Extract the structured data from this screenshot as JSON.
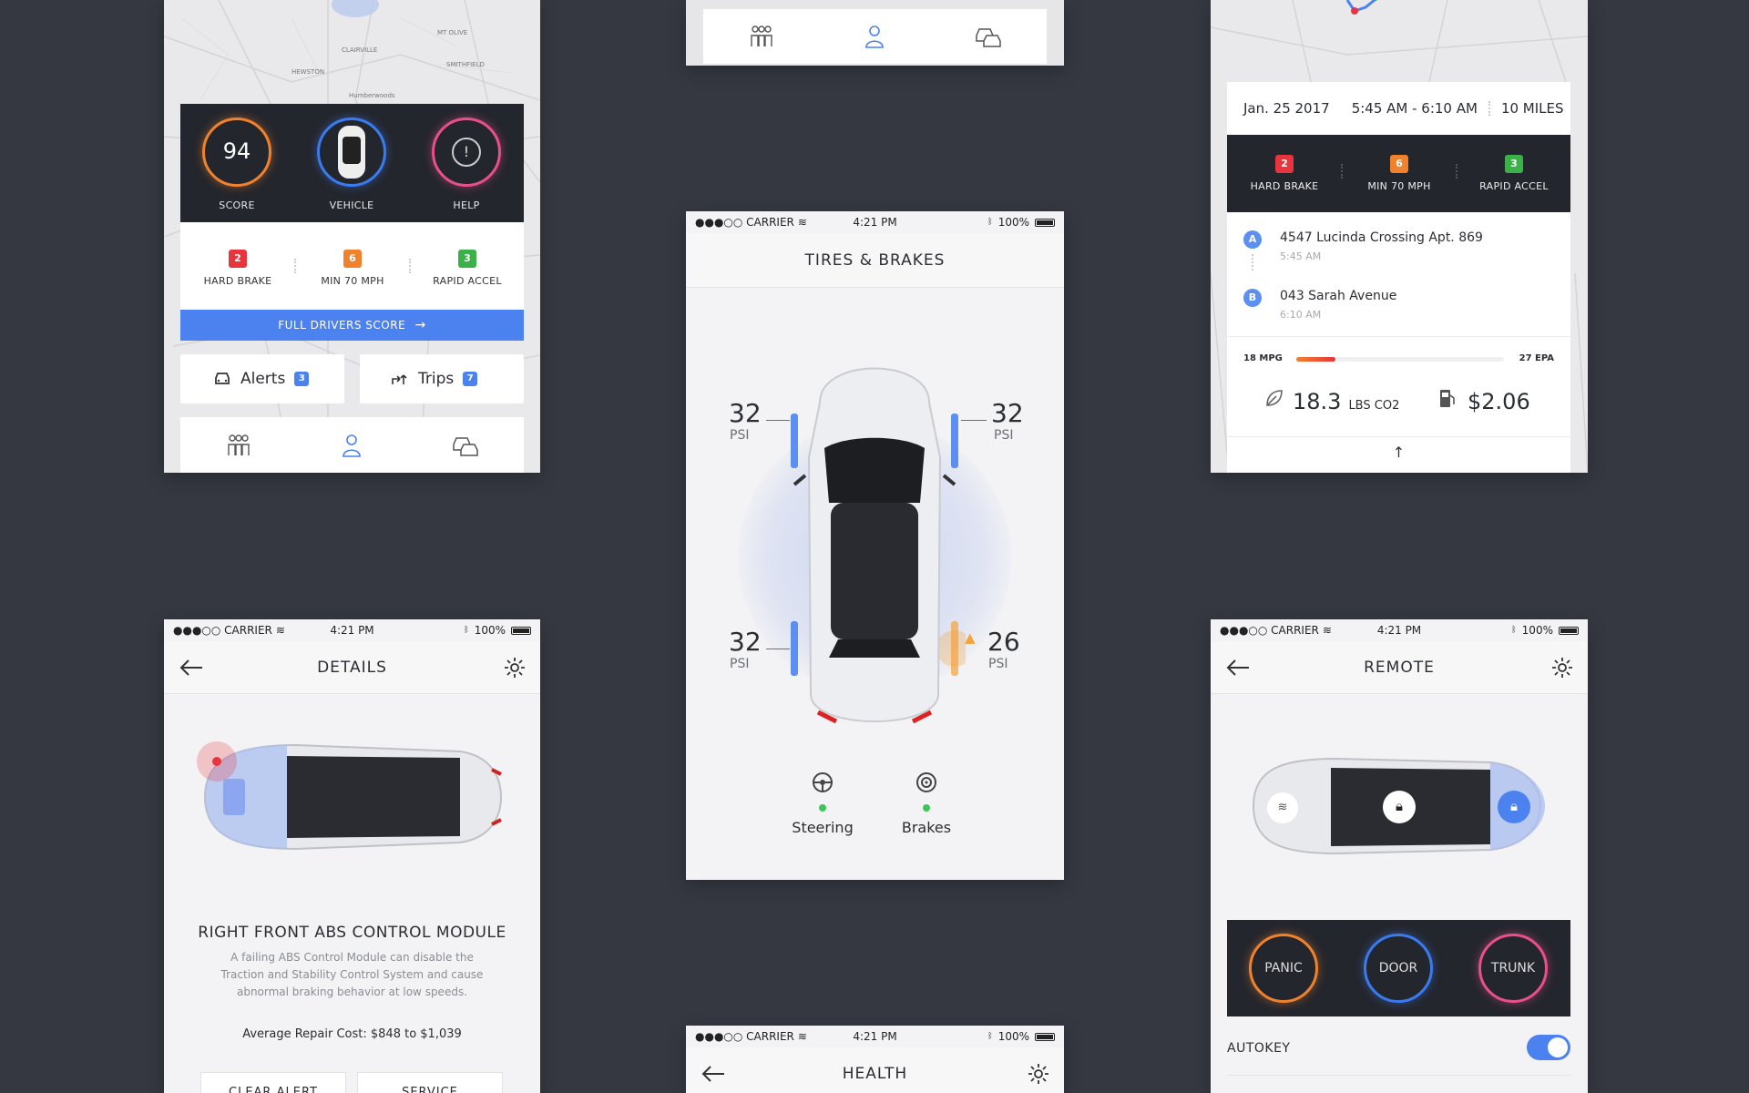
{
  "colors": {
    "background": "#353841",
    "accent_blue": "#4b82f0",
    "badge_red": "#e8343c",
    "badge_orange": "#f0822d",
    "badge_green": "#3cb049",
    "dark_panel": "#24262d",
    "status_ok_green": "#3cc55a",
    "warning_orange": "#f5a33b"
  },
  "dashboard": {
    "map_labels": [
      "CLAIRVILLE",
      "MT OLIVE",
      "SMITHFIELD",
      "HEWSTON",
      "Humberwoods"
    ],
    "score": {
      "value": "94",
      "label": "SCORE"
    },
    "vehicle_label": "VEHICLE",
    "help_label": "HELP",
    "metrics": [
      {
        "count": "2",
        "label": "HARD BRAKE"
      },
      {
        "count": "6",
        "label": "MIN 70 MPH"
      },
      {
        "count": "3",
        "label": "RAPID ACCEL"
      }
    ],
    "full_score_button": "FULL DRIVERS SCORE",
    "alerts": {
      "label": "Alerts",
      "count": "3"
    },
    "trips": {
      "label": "Trips",
      "count": "7"
    },
    "tabs": [
      "people-icon",
      "person-icon",
      "cars-icon"
    ]
  },
  "status_bar": {
    "carrier": "●●●○○ CARRIER",
    "time": "4:21 PM",
    "battery": "100%"
  },
  "tires": {
    "title": "TIRES & BRAKES",
    "front_left": {
      "value": "32",
      "unit": "PSI"
    },
    "front_right": {
      "value": "32",
      "unit": "PSI"
    },
    "rear_left": {
      "value": "32",
      "unit": "PSI"
    },
    "rear_right": {
      "value": "26",
      "unit": "PSI"
    },
    "steering_label": "Steering",
    "brakes_label": "Brakes"
  },
  "trip": {
    "date": "Jan. 25 2017",
    "time_range": "5:45 AM - 6:10 AM",
    "distance": "10 MILES",
    "metrics": [
      {
        "count": "2",
        "label": "HARD BRAKE"
      },
      {
        "count": "6",
        "label": "MIN 70 MPH"
      },
      {
        "count": "3",
        "label": "RAPID ACCEL"
      }
    ],
    "start": {
      "marker": "A",
      "address": "4547 Lucinda Crossing Apt. 869",
      "time": "5:45 AM"
    },
    "end": {
      "marker": "B",
      "address": "043 Sarah Avenue",
      "time": "6:10 AM"
    },
    "mpg_label": "18 MPG",
    "epa_label": "27 EPA",
    "mpg_fraction": 0.19,
    "co2_value": "18.3",
    "co2_unit": "LBS CO2",
    "cost": "$2.06"
  },
  "details": {
    "title": "DETAILS",
    "module_title": "RIGHT FRONT ABS CONTROL MODULE",
    "description": "A failing ABS Control Module can disable the Traction and Stability Control System and cause abnormal braking behavior at low speeds.",
    "repair_cost": "Average Repair Cost: $848 to $1,039",
    "clear_alert": "CLEAR ALERT",
    "service": "SERVICE"
  },
  "health": {
    "title": "HEALTH"
  },
  "remote": {
    "title": "REMOTE",
    "panic": "PANIC",
    "door": "DOOR",
    "trunk": "TRUNK",
    "autokey": "AUTOKEY"
  }
}
